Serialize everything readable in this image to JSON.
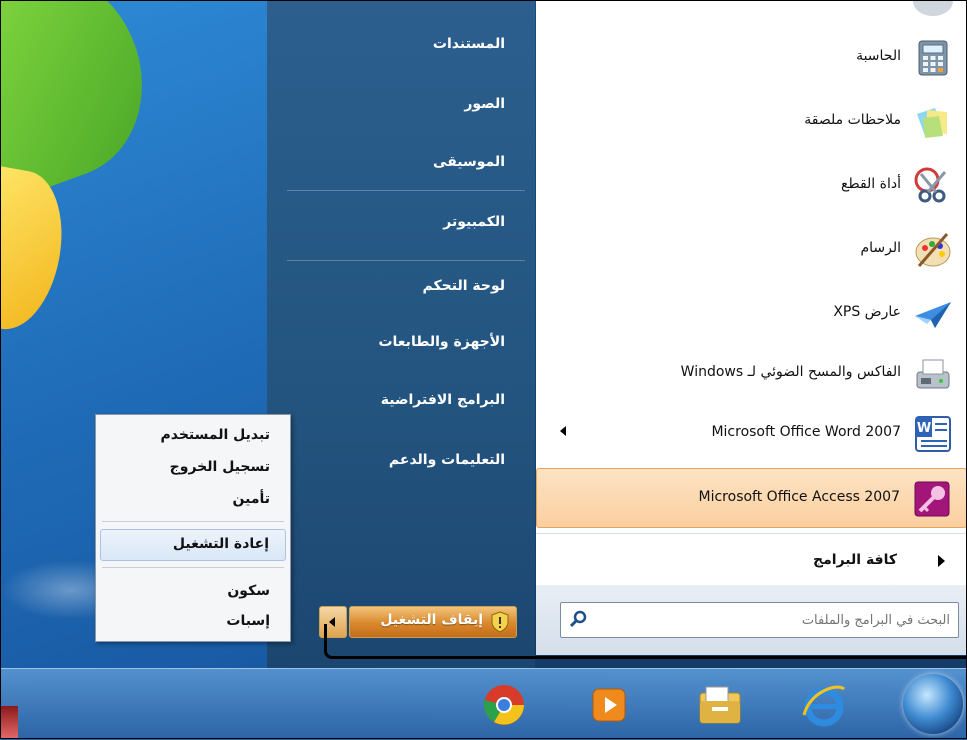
{
  "right_pane": {
    "items": [
      "المستندات",
      "الصور",
      "الموسيقى",
      "الكمبيوتر",
      "لوحة التحكم",
      "الأجهزة والطابعات",
      "البرامج الافتراضية",
      "التعليمات والدعم"
    ]
  },
  "programs": [
    {
      "label": "الحاسبة",
      "icon": "calculator-icon"
    },
    {
      "label": "ملاحظات ملصقة",
      "icon": "sticky-notes-icon"
    },
    {
      "label": "أداة القطع",
      "icon": "snipping-tool-icon"
    },
    {
      "label": "الرسام",
      "icon": "paint-palette-icon"
    },
    {
      "label": "عارض XPS",
      "icon": "xps-viewer-icon"
    },
    {
      "label": "الفاكس والمسح الضوئي لـ Windows",
      "icon": "fax-scan-icon"
    },
    {
      "label": "Microsoft Office Word 2007",
      "icon": "word-icon"
    },
    {
      "label": "Microsoft Office Access 2007",
      "icon": "access-icon"
    }
  ],
  "all_programs": "كافة البرامج",
  "search": {
    "placeholder": "البحث في البرامج والملفات"
  },
  "shutdown": {
    "label": "إيقاف التشغيل"
  },
  "popup": {
    "items": [
      "تبديل المستخدم",
      "تسجيل الخروج",
      "تأمين",
      "إعادة التشغيل",
      "سكون",
      "إسبات"
    ]
  },
  "taskbar": {
    "icons": [
      "chrome-icon",
      "media-player-icon",
      "file-explorer-icon",
      "internet-explorer-icon"
    ]
  },
  "colors": {
    "accent": "#fbcf9f",
    "menu_blue": "#23547f"
  }
}
